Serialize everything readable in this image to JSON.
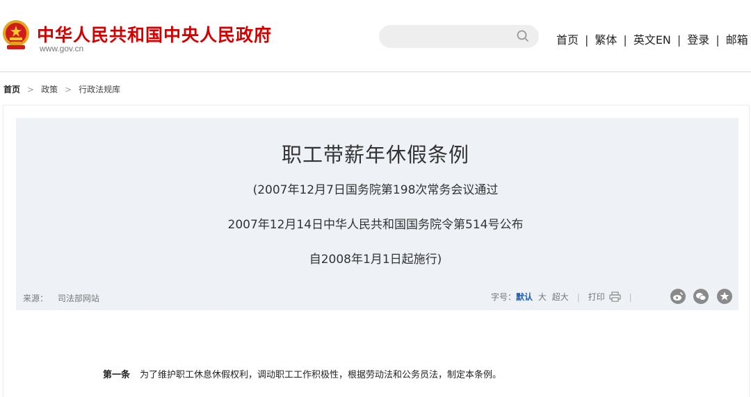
{
  "header": {
    "site_title": "中华人民共和国中央人民政府",
    "site_url": "www.gov.cn",
    "search": {
      "placeholder": ""
    },
    "nav": [
      "首页",
      "繁体",
      "英文EN",
      "登录",
      "邮箱"
    ]
  },
  "breadcrumb": {
    "home": "首页",
    "policy": "政策",
    "library": "行政法规库"
  },
  "article": {
    "title": "职工带薪年休假条例",
    "sub1": "(2007年12月7日国务院第198次常务会议通过",
    "sub2": "2007年12月14日中华人民共和国国务院令第514号公布",
    "sub3": "自2008年1月1日起施行)",
    "source_label": "来源：",
    "source_value": "司法部网站",
    "font_label": "字号：",
    "font_default": "默认",
    "font_large": "大",
    "font_xlarge": "超大",
    "print_label": "打印",
    "clause_label": "第一条",
    "clause_text": "为了维护职工休息休假权利，调动职工工作积极性，根据劳动法和公务员法，制定本条例。"
  },
  "icons": {
    "search": "search-icon",
    "print": "print-icon",
    "weibo": "weibo-icon",
    "wechat": "wechat-icon",
    "star": "favorite-icon"
  },
  "colors": {
    "brand_red": "#d40000",
    "title_bg": "#eef1f6",
    "link_blue": "#1f5fb0"
  }
}
